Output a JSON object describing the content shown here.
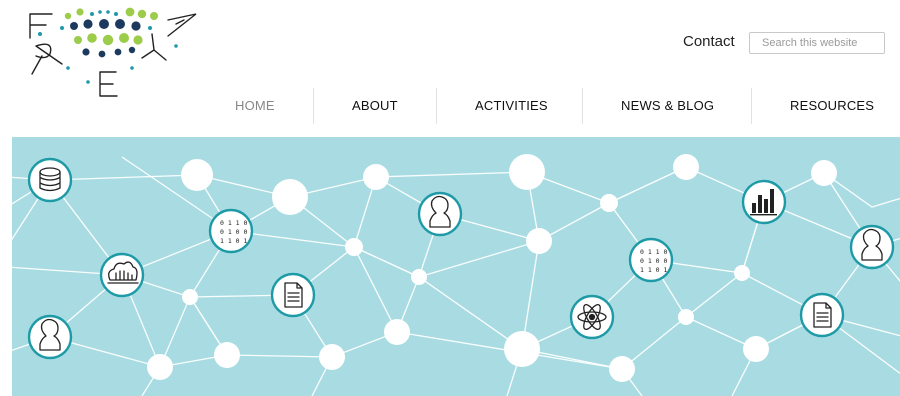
{
  "brand": {
    "name": "FREYA",
    "logo_icon": "freya-dots-logo",
    "colors": {
      "navy": "#1c3a5e",
      "teal": "#1e9aa6",
      "green": "#9ccc4a",
      "lime": "#c5dc6a"
    }
  },
  "header": {
    "contact_label": "Contact",
    "search_placeholder": "Search this website"
  },
  "nav": {
    "items": [
      {
        "label": "HOME",
        "active": true
      },
      {
        "label": "ABOUT",
        "active": false
      },
      {
        "label": "ACTIVITIES",
        "active": false
      },
      {
        "label": "NEWS & BLOG",
        "active": false
      },
      {
        "label": "RESOURCES",
        "active": false
      }
    ]
  },
  "banner": {
    "background": "#a8dce2",
    "node_ring_color": "#1e9aa6",
    "icons": [
      "database-icon",
      "cloud-network-icon",
      "binary-data-icon",
      "document-icon",
      "person-icon",
      "atom-icon",
      "bar-chart-icon",
      "binary-data-icon",
      "person-icon",
      "document-icon",
      "person-icon"
    ]
  }
}
